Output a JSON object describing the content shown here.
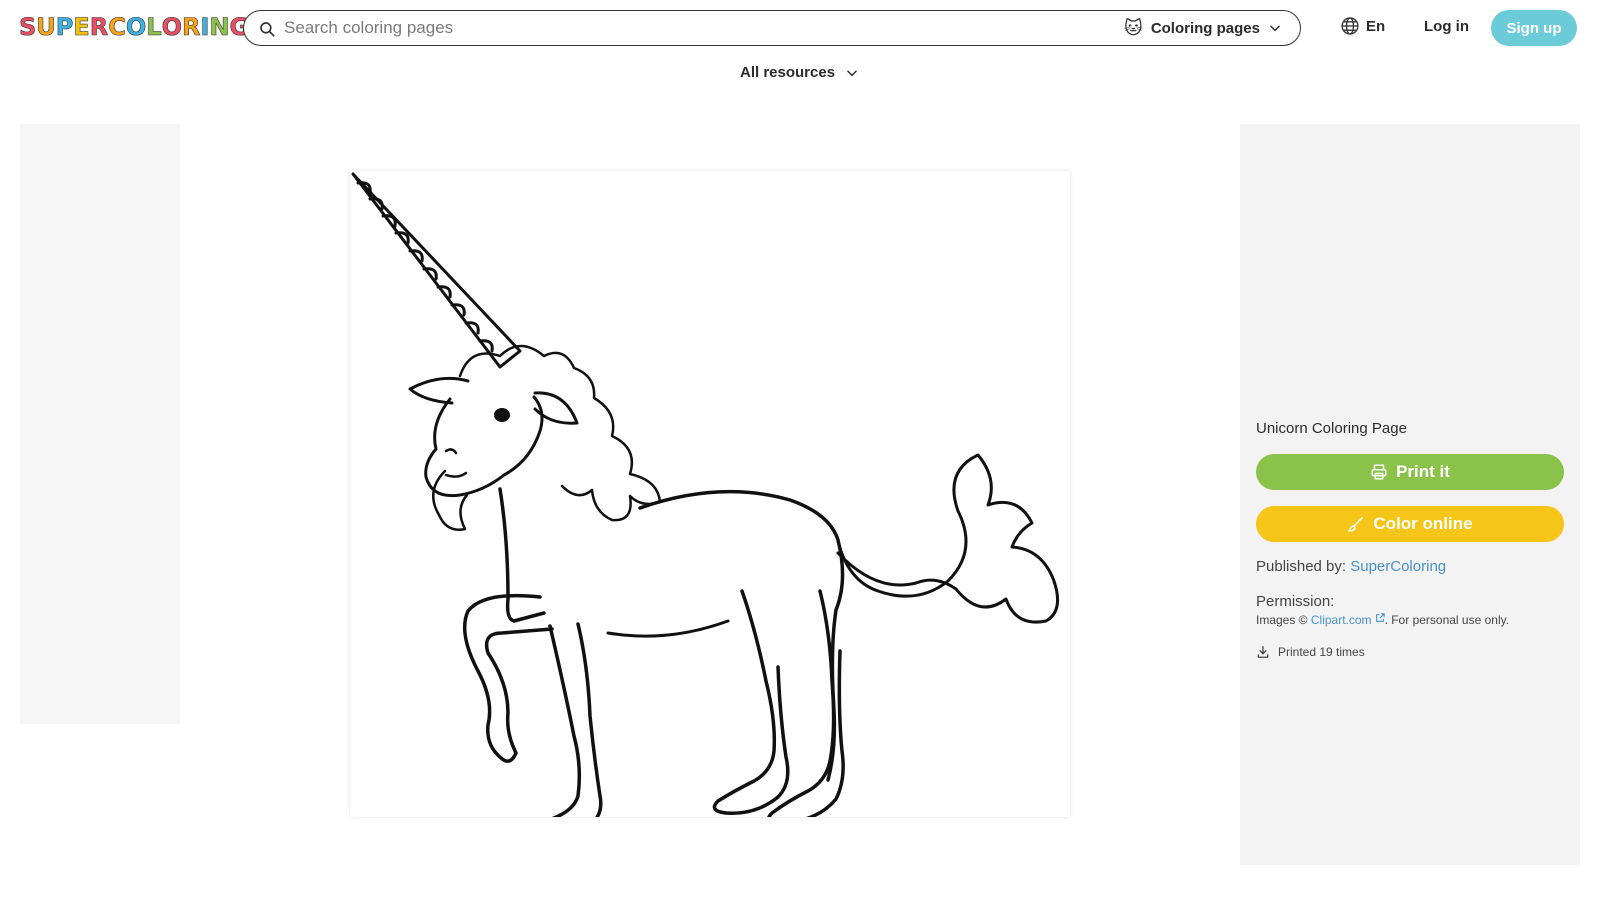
{
  "logo": {
    "letters": [
      "S",
      "U",
      "P",
      "E",
      "R",
      "C",
      "O",
      "L",
      "O",
      "R",
      "I",
      "N",
      "G"
    ],
    "colors": [
      "#e94f64",
      "#f4a31c",
      "#3fb0e0",
      "#f4c20d",
      "#e94f64",
      "#f4a31c",
      "#3fb0e0",
      "#8bc34a",
      "#e94f64",
      "#f4a31c",
      "#3fb0e0",
      "#8bc34a",
      "#e94f64"
    ]
  },
  "search": {
    "placeholder": "Search coloring pages",
    "category_emoji": "🐱",
    "category_label": "Coloring pages"
  },
  "header": {
    "language": "En",
    "login": "Log in",
    "signup": "Sign up"
  },
  "resources": {
    "label": "All resources"
  },
  "panel": {
    "title": "Unicorn Coloring Page",
    "print_label": "Print it",
    "color_label": "Color online",
    "published_prefix": "Published by:",
    "publisher": "SuperColoring",
    "permission_label": "Permission:",
    "permission_prefix": "Images ©",
    "permission_link": "Clipart.com",
    "permission_suffix": ". For personal use only.",
    "printed": "Printed 19 times"
  },
  "colors": {
    "signup_bg": "#6ccbd8",
    "print_bg": "#8bc34a",
    "color_online_bg": "#f5c518",
    "link": "#4a90c8",
    "panel_bg": "#f3f3f3",
    "ad_bg": "#f6f6f6"
  },
  "icons": {
    "search": "search-icon",
    "chevron": "chevron-down-icon",
    "globe": "globe-icon",
    "printer": "printer-icon",
    "brush": "brush-icon",
    "external": "external-link-icon",
    "download": "download-icon"
  }
}
